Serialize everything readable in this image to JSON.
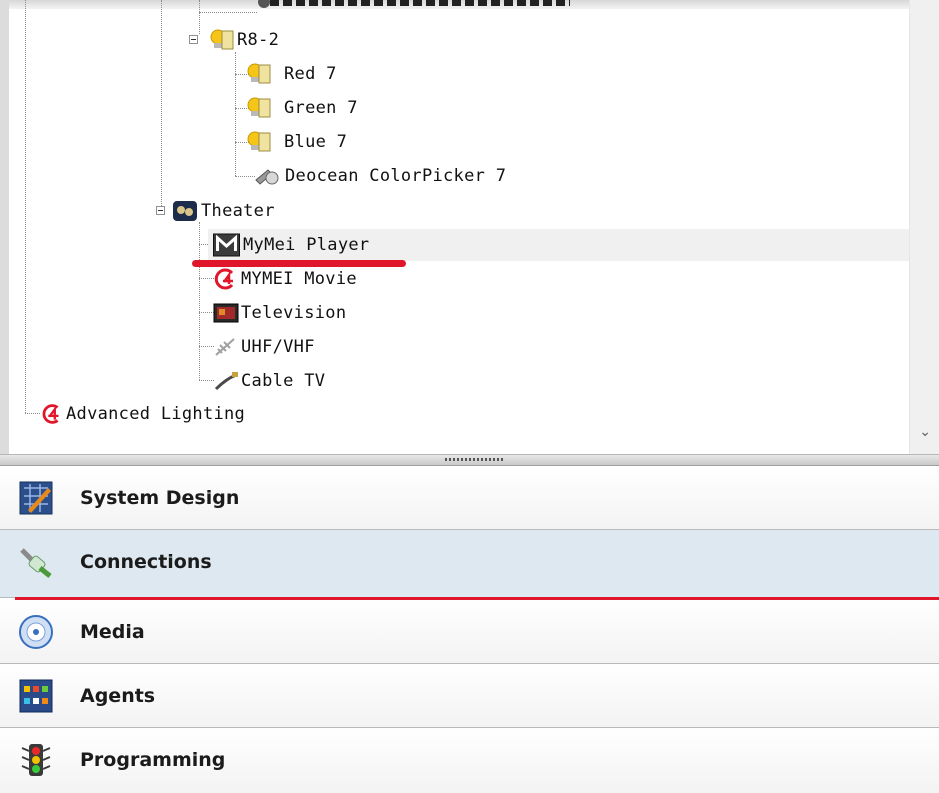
{
  "tree": {
    "items": [
      {
        "label": "R8-2"
      },
      {
        "label": "Red 7"
      },
      {
        "label": "Green 7"
      },
      {
        "label": "Blue 7"
      },
      {
        "label": "Deocean ColorPicker 7"
      },
      {
        "label": "Theater"
      },
      {
        "label": "MyMei Player"
      },
      {
        "label": "MYMEI Movie"
      },
      {
        "label": "Television"
      },
      {
        "label": "UHF/VHF"
      },
      {
        "label": "Cable TV"
      },
      {
        "label": "Advanced Lighting"
      }
    ]
  },
  "nav": {
    "items": [
      {
        "label": "System Design",
        "icon": "system-design-icon"
      },
      {
        "label": "Connections",
        "icon": "connections-icon",
        "active": true
      },
      {
        "label": "Media",
        "icon": "media-icon"
      },
      {
        "label": "Agents",
        "icon": "agents-icon"
      },
      {
        "label": "Programming",
        "icon": "programming-icon"
      }
    ]
  },
  "colors": {
    "highlight_red": "#e0162b",
    "active_nav_bg": "#dde8f0",
    "selected_row_bg": "#f0f0f0"
  }
}
